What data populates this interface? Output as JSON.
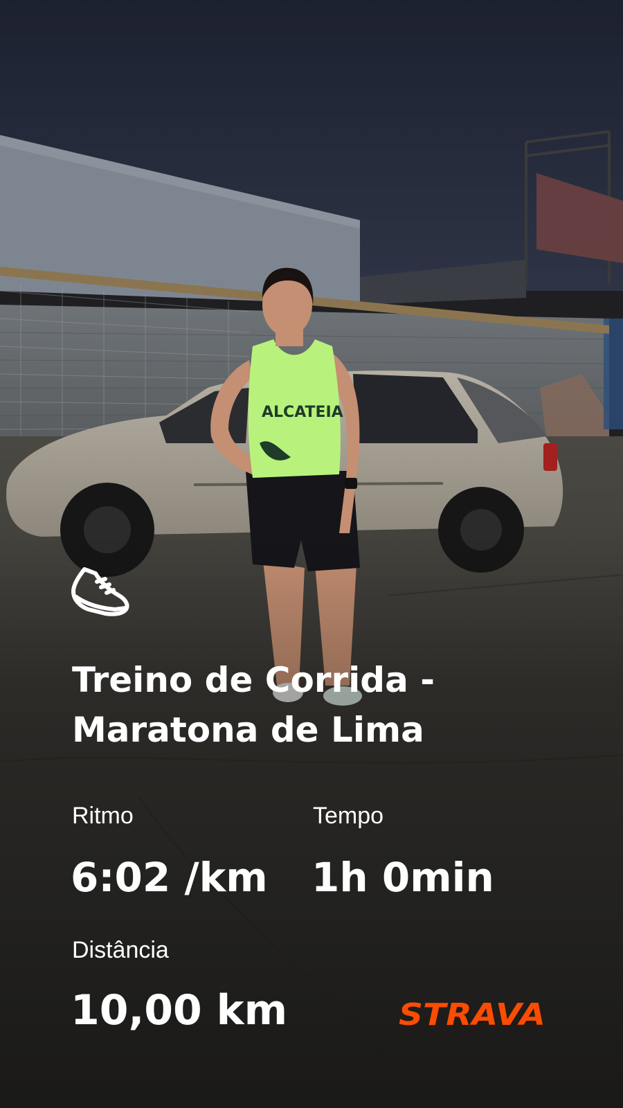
{
  "activity": {
    "title": "Treino de Corrida - Maratona de Lima",
    "icon": "running-shoe-icon"
  },
  "stats": {
    "pace": {
      "label": "Ritmo",
      "value": "6:02 /km"
    },
    "time": {
      "label": "Tempo",
      "value": "1h 0min"
    },
    "distance": {
      "label": "Distância",
      "value": "10,00 km"
    }
  },
  "photo": {
    "shirt_text": "ALCATEIA"
  },
  "brand": {
    "name": "STRAVA",
    "color": "#fc4c02"
  },
  "colors": {
    "text": "#ffffff",
    "shirt": "#b8f27c"
  }
}
